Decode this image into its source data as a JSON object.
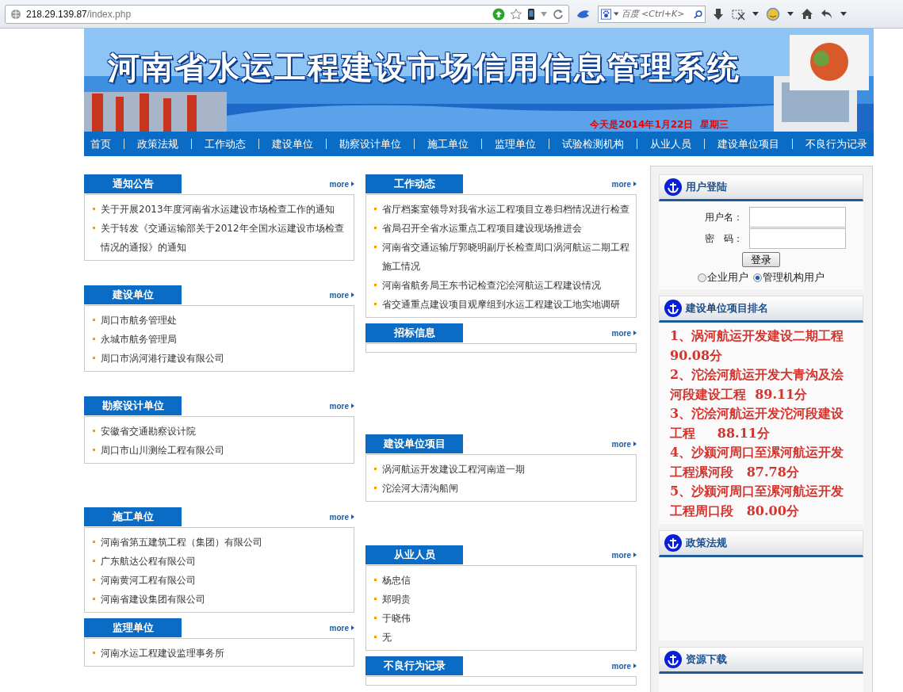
{
  "browser": {
    "url_host": "218.29.139.87",
    "url_path": "/index.php",
    "search_placeholder": "百度 <Ctrl+K>"
  },
  "banner": {
    "title": "河南省水运工程建设市场信用信息管理系统",
    "date": "今天是2014年1月22日  星期三"
  },
  "nav": [
    {
      "label": "首页"
    },
    {
      "label": "政策法规"
    },
    {
      "label": "工作动态"
    },
    {
      "label": "建设单位"
    },
    {
      "label": "勘察设计单位"
    },
    {
      "label": "施工单位"
    },
    {
      "label": "监理单位"
    },
    {
      "label": "试验检测机构"
    },
    {
      "label": "从业人员"
    },
    {
      "label": "建设单位项目"
    },
    {
      "label": "不良行为记录"
    }
  ],
  "left_sections": [
    {
      "title": "通知公告",
      "more": "more",
      "items": [
        "关于开展2013年度河南省水运建设市场检查工作的通知",
        "关于转发《交通运输部关于2012年全国水运建设市场检查情况的通报》的通知"
      ]
    },
    {
      "title": "建设单位",
      "more": "more",
      "items": [
        "周口市航务管理处",
        "永城市航务管理局",
        "周口市涡河港行建设有限公司"
      ]
    },
    {
      "title": "勘察设计单位",
      "more": "more",
      "items": [
        "安徽省交通勘察设计院",
        "周口市山川测绘工程有限公司"
      ]
    },
    {
      "title": "施工单位",
      "more": "more",
      "items": [
        "河南省第五建筑工程（集团）有限公司",
        "广东航达公程有限公司",
        "河南黄河工程有限公司",
        "河南省建设集团有限公司"
      ]
    },
    {
      "title": "监理单位",
      "more": "more",
      "items": [
        "河南水运工程建设监理事务所"
      ]
    }
  ],
  "middle_sections": [
    {
      "title": "工作动态",
      "more": "more",
      "items": [
        "省厅档案室领导对我省水运工程项目立卷归档情况进行检查",
        "省局召开全省水运重点工程项目建设现场推进会",
        "河南省交通运输厅郭晓明副厅长检查周口涡河航运二期工程施工情况",
        "河南省航务局王东书记检查沱浍河航运工程建设情况",
        "省交通重点建设项目观摩组到水运工程建设工地实地调研"
      ]
    },
    {
      "title": "招标信息",
      "more": "more"
    },
    {
      "title": "建设单位项目",
      "more": "more",
      "items": [
        "涡河航运开发建设工程河南道一期",
        "沱浍河大清沟船闸"
      ]
    },
    {
      "title": "从业人员",
      "more": "more",
      "items": [
        "杨忠信",
        "郑明贵",
        "于晓伟",
        "无"
      ]
    },
    {
      "title": "不良行为记录",
      "more": "more"
    }
  ],
  "login": {
    "title": "用户登陆",
    "username_label": "用户名：",
    "password_label": "密　码：",
    "button": "登录",
    "user_types": [
      {
        "label": "企业用户",
        "selected": false
      },
      {
        "label": "管理机构用户",
        "selected": true
      }
    ]
  },
  "ranking": {
    "title": "建设单位项目排名",
    "items": [
      "1、涡河航运开发建设二期工程 90.08分",
      "2、沱浍河航运开发大青沟及浍河段建设工程  89.11分",
      "3、沱浍河航运开发沱河段建设工程     88.11分",
      "4、沙颍河周口至漯河航运开发工程漯河段   87.78分",
      "5、沙颍河周口至漯河航运开发工程周口段   80.00分"
    ]
  },
  "side_panels": [
    {
      "title": "政策法规"
    },
    {
      "title": "资源下载"
    }
  ]
}
